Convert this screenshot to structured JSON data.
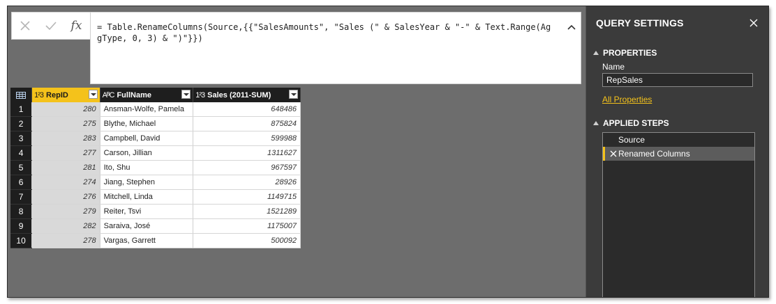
{
  "formula_bar": {
    "cancel_icon": "close-icon",
    "commit_icon": "check-icon",
    "fx_label": "fx",
    "formula": "= Table.RenameColumns(Source,{{\"SalesAmounts\", \"Sales (\" & SalesYear & \"-\" & Text.Range(AggType, 0, 3) & \")\"}})"
  },
  "grid": {
    "columns": [
      {
        "type_icon": "1²3",
        "name": "RepID"
      },
      {
        "type_icon": "AᴮC",
        "name": "FullName"
      },
      {
        "type_icon": "1²3",
        "name": "Sales (2011-SUM)"
      }
    ],
    "rows": [
      {
        "n": "1",
        "id": "280",
        "name": "Ansman-Wolfe, Pamela",
        "sales": "648486"
      },
      {
        "n": "2",
        "id": "275",
        "name": "Blythe, Michael",
        "sales": "875824"
      },
      {
        "n": "3",
        "id": "283",
        "name": "Campbell, David",
        "sales": "599988"
      },
      {
        "n": "4",
        "id": "277",
        "name": "Carson, Jillian",
        "sales": "1311627"
      },
      {
        "n": "5",
        "id": "281",
        "name": "Ito, Shu",
        "sales": "967597"
      },
      {
        "n": "6",
        "id": "274",
        "name": "Jiang, Stephen",
        "sales": "28926"
      },
      {
        "n": "7",
        "id": "276",
        "name": "Mitchell, Linda",
        "sales": "1149715"
      },
      {
        "n": "8",
        "id": "279",
        "name": "Reiter, Tsvi",
        "sales": "1521289"
      },
      {
        "n": "9",
        "id": "282",
        "name": "Saraiva, José",
        "sales": "1175007"
      },
      {
        "n": "10",
        "id": "278",
        "name": "Vargas, Garrett",
        "sales": "500092"
      }
    ]
  },
  "query_settings": {
    "title": "QUERY SETTINGS",
    "properties_title": "PROPERTIES",
    "name_label": "Name",
    "name_value": "RepSales",
    "all_properties": "All Properties",
    "applied_steps_title": "APPLIED STEPS",
    "steps": [
      "Source",
      "Renamed Columns"
    ]
  },
  "colors": {
    "accent": "#f4c21b",
    "panel": "#3b3b3b",
    "canvas": "#6d6d6d"
  }
}
